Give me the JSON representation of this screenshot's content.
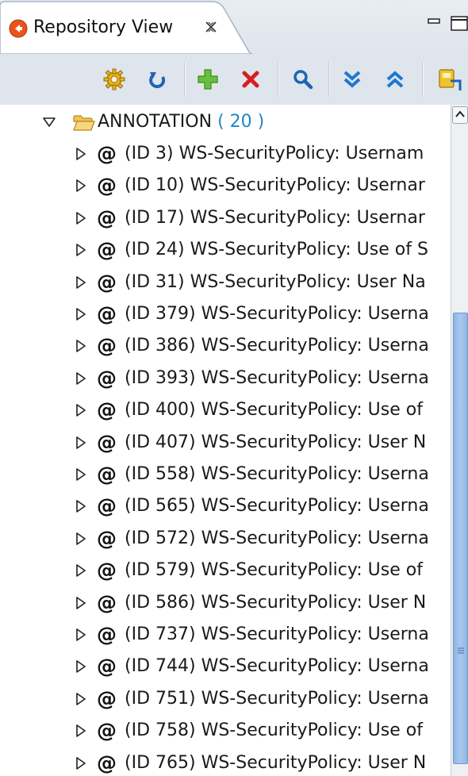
{
  "tab": {
    "title": "Repository View",
    "icon": "repository-icon",
    "close_icon": "close-icon"
  },
  "window_controls": [
    "minimize-icon",
    "maximize-icon"
  ],
  "toolbar": {
    "buttons": [
      {
        "name": "configure-button",
        "icon": "gear-icon"
      },
      {
        "name": "refresh-button",
        "icon": "refresh-icon"
      },
      {
        "name": "add-button",
        "icon": "add-icon"
      },
      {
        "name": "delete-button",
        "icon": "delete-icon"
      },
      {
        "name": "search-button",
        "icon": "search-icon"
      },
      {
        "name": "expand-all-button",
        "icon": "expand-all-icon"
      },
      {
        "name": "collapse-all-button",
        "icon": "collapse-all-icon"
      },
      {
        "name": "import-button",
        "icon": "import-icon"
      }
    ]
  },
  "tree": {
    "root": {
      "label": "ANNOTATION",
      "count": "( 20 )",
      "expanded": true
    },
    "items": [
      {
        "at": "@",
        "label": "(ID 3) WS-SecurityPolicy: Usernam"
      },
      {
        "at": "@",
        "label": "(ID 10) WS-SecurityPolicy: Usernar"
      },
      {
        "at": "@",
        "label": "(ID 17) WS-SecurityPolicy: Usernar"
      },
      {
        "at": "@",
        "label": "(ID 24) WS-SecurityPolicy: Use of S"
      },
      {
        "at": "@",
        "label": "(ID 31) WS-SecurityPolicy: User Na"
      },
      {
        "at": "@",
        "label": "(ID 379) WS-SecurityPolicy: Userna"
      },
      {
        "at": "@",
        "label": "(ID 386) WS-SecurityPolicy: Userna"
      },
      {
        "at": "@",
        "label": "(ID 393) WS-SecurityPolicy: Userna"
      },
      {
        "at": "@",
        "label": "(ID 400) WS-SecurityPolicy: Use of"
      },
      {
        "at": "@",
        "label": "(ID 407) WS-SecurityPolicy: User N"
      },
      {
        "at": "@",
        "label": "(ID 558) WS-SecurityPolicy: Userna"
      },
      {
        "at": "@",
        "label": "(ID 565) WS-SecurityPolicy: Userna"
      },
      {
        "at": "@",
        "label": "(ID 572) WS-SecurityPolicy: Userna"
      },
      {
        "at": "@",
        "label": "(ID 579) WS-SecurityPolicy: Use of"
      },
      {
        "at": "@",
        "label": "(ID 586) WS-SecurityPolicy: User N"
      },
      {
        "at": "@",
        "label": "(ID 737) WS-SecurityPolicy: Userna"
      },
      {
        "at": "@",
        "label": "(ID 744) WS-SecurityPolicy: Userna"
      },
      {
        "at": "@",
        "label": "(ID 751) WS-SecurityPolicy: Userna"
      },
      {
        "at": "@",
        "label": "(ID 758) WS-SecurityPolicy: Use of"
      },
      {
        "at": "@",
        "label": "(ID 765) WS-SecurityPolicy: User N"
      }
    ]
  },
  "scrollbar": {
    "position": 0.31,
    "visible_fraction": 0.69
  }
}
